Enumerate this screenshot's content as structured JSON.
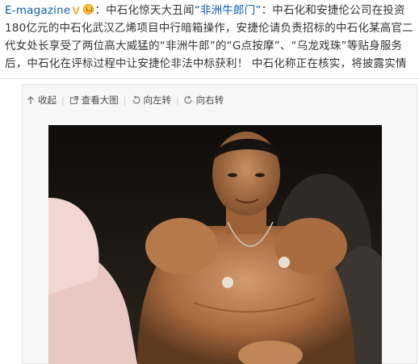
{
  "post": {
    "author": "E-magazine",
    "colon": "：",
    "text_before_topic": "中石化惊天大丑闻",
    "topic": "“非洲牛郎门”",
    "text_after_topic": "：中石化和安捷伦公司在投资180亿元的中石化武汉乙烯项目中行暗箱操作，安捷伦请负责招标的中石化某高官二代女处长享受了两位高大威猛的“非洲牛郎”的“G点按摩”、“乌龙戏珠”等贴身服务后，中石化在评标过程中让安捷伦非法中标获利！ 中石化称正在核实，将披露实情"
  },
  "toolbar": {
    "collapse": "收起",
    "view_large": "查看大图",
    "rotate_left": "向左转",
    "rotate_right": "向右转",
    "separator": "|"
  },
  "icons": {
    "collapse": "arrow-up-icon",
    "view_large": "external-link-icon",
    "rotate_left": "rotate-left-icon",
    "rotate_right": "rotate-right-icon",
    "verified": "verified-v-icon",
    "crown": "crown-badge-icon"
  },
  "colors": {
    "link": "#0a5bb3",
    "text": "#333333",
    "badge": "#f5a623"
  }
}
